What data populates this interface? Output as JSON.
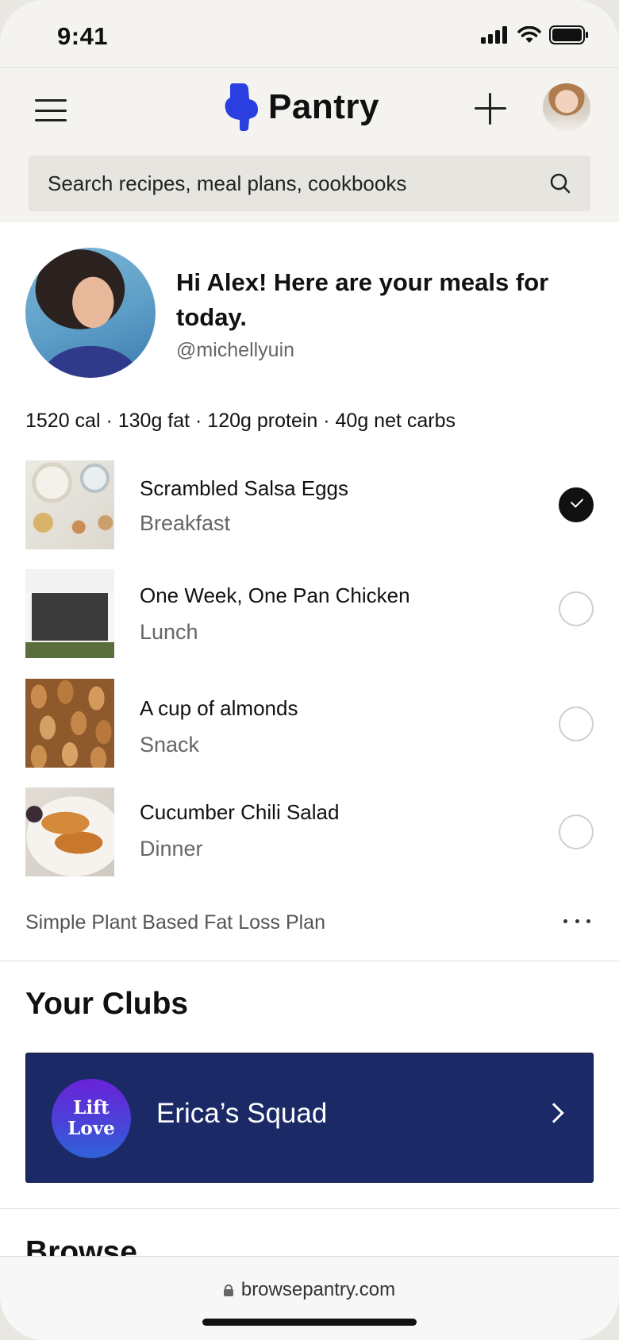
{
  "status_bar": {
    "time": "9:41"
  },
  "header": {
    "app_name": "Pantry",
    "search_placeholder": "Search recipes, meal plans, cookbooks",
    "brand_color": "#2b3fe0"
  },
  "greeting": {
    "title": "Hi Alex! Here are your meals for today.",
    "handle": "@michellyuin"
  },
  "macros": "1520 cal · 130g fat · 120g protein · 40g net carbs",
  "meals": [
    {
      "name": "Scrambled Salsa Eggs",
      "type": "Breakfast",
      "done": true
    },
    {
      "name": "One Week, One Pan Chicken",
      "type": "Lunch",
      "done": false
    },
    {
      "name": "A cup of almonds",
      "type": "Snack",
      "done": false
    },
    {
      "name": "Cucumber Chili Salad",
      "type": "Dinner",
      "done": false
    }
  ],
  "plan_name": "Simple Plant Based Fat Loss Plan",
  "clubs": {
    "section_title": "Your Clubs",
    "items": [
      {
        "badge_line1": "Lift",
        "badge_line2": "Love",
        "name": "Erica’s Squad",
        "color": "#1b2a66"
      }
    ]
  },
  "browse": {
    "section_title": "Browse"
  },
  "browser": {
    "url": "browsepantry.com"
  }
}
